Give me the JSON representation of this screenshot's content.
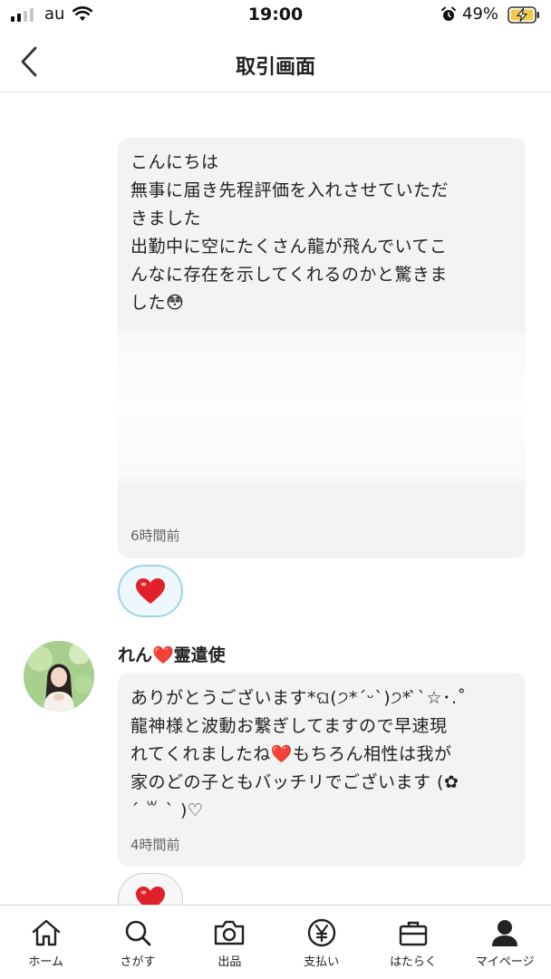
{
  "status_bar": {
    "carrier": "au",
    "time": "19:00",
    "battery_percent": "49%",
    "signal_bars_filled": 2,
    "signal_bars_total": 4,
    "icons": [
      "signal-icon",
      "wifi-icon",
      "alarm-icon",
      "battery-charging-icon"
    ]
  },
  "header": {
    "title": "取引画面",
    "back_icon": "chevron-left-icon"
  },
  "messages": [
    {
      "text": "こんにちは\n無事に届き先程評価を入れさせていただ\nきました\n出勤中に空にたくさん龍が飛んでいてこ\nんなに存在を示してくれるのかと驚きま\nした😳",
      "time": "6時間前",
      "obscured_content": true
    },
    {
      "sender": "れん❤️霊遣使",
      "text": "ありがとうございます*ଘ(੭*ˊᵕˋ)੭* ̀ˋ☆･.˚\n龍神様と波動お繋ぎしてますので早速現\nれてくれましたね❤️もちろん相性は我が\n家のどの子ともバッチリでございます (✿\nˊ ꒳ ˋ )♡",
      "time": "4時間前"
    }
  ],
  "reaction_icon": "heart-icon",
  "accent_colors": {
    "heart": "#e0202a",
    "like_border": "#9fd3ea",
    "bubble_bg": "#f3f3f3"
  },
  "tabbar": {
    "items": [
      {
        "label": "ホーム",
        "icon": "home-icon"
      },
      {
        "label": "さがす",
        "icon": "search-icon"
      },
      {
        "label": "出品",
        "icon": "camera-icon"
      },
      {
        "label": "支払い",
        "icon": "yen-icon"
      },
      {
        "label": "はたらく",
        "icon": "briefcase-icon"
      },
      {
        "label": "マイページ",
        "icon": "person-icon"
      }
    ]
  }
}
